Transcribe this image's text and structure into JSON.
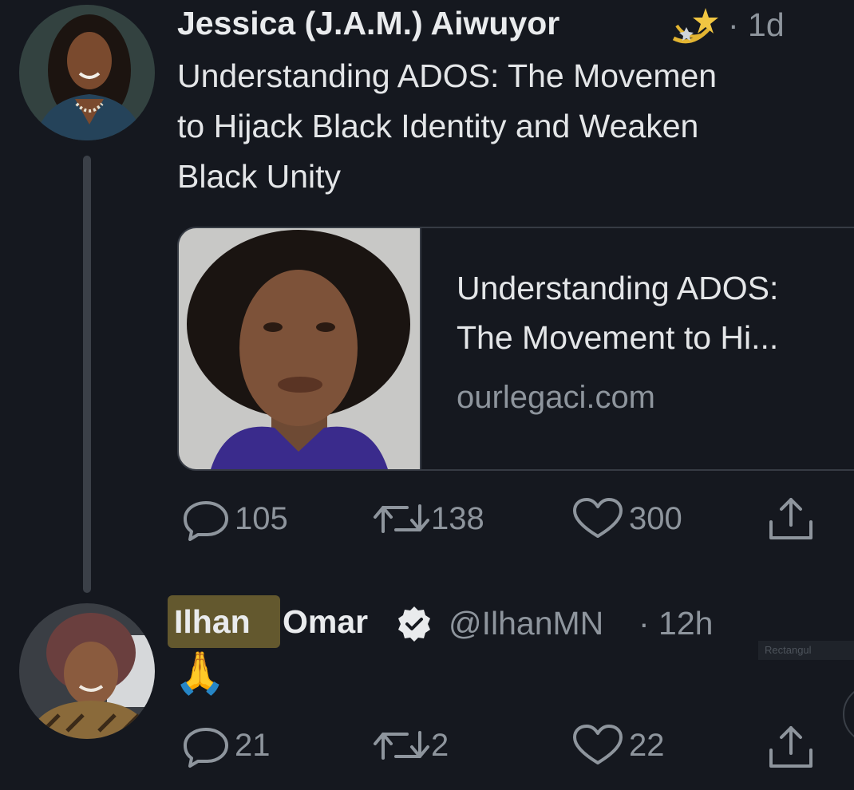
{
  "tweet1": {
    "author_name": "Jessica (J.A.M.) Aiwuyor",
    "name_emoji": "shooting-star-icon",
    "time": "· 1d",
    "text_lines": [
      "Understanding ADOS: The Movemen",
      "to Hijack Black Identity and Weaken",
      "Black Unity"
    ],
    "card": {
      "title_lines": [
        "Understanding ADOS:",
        "The Movement to Hi..."
      ],
      "domain": "ourlegaci.com"
    },
    "actions": {
      "reply_icon": "reply-icon",
      "replies": "105",
      "retweet_icon": "retweet-icon",
      "retweets": "138",
      "like_icon": "heart-icon",
      "likes": "300",
      "share_icon": "share-icon"
    }
  },
  "tweet2": {
    "first_name": "Ilhan",
    "last_name": "Omar",
    "verified_icon": "verified-badge-icon",
    "handle": "@IlhanMN",
    "time": "· 12h",
    "text": "🙏",
    "actions": {
      "replies": "21",
      "retweets": "2",
      "likes": "22"
    }
  },
  "overlay": {
    "badge": "Rectangul"
  },
  "colors": {
    "background": "#15181f",
    "muted": "#8e959d",
    "highlight": "#63582e",
    "verified": "#e9ebed"
  }
}
